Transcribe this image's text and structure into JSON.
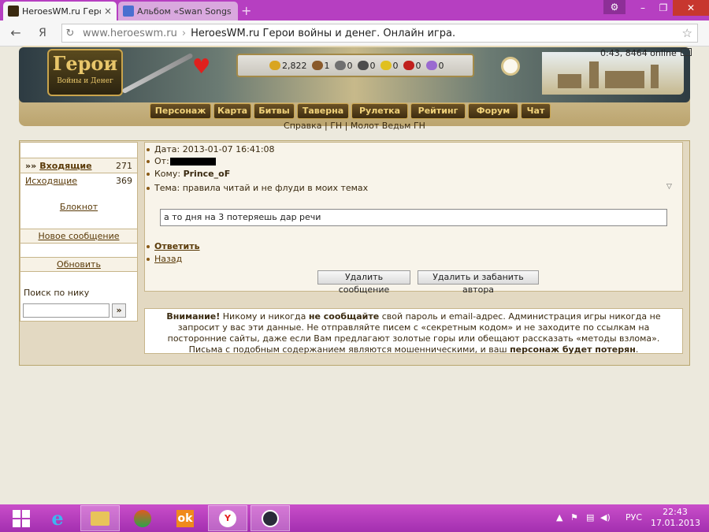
{
  "browser": {
    "tabs": [
      {
        "title": "HeroesWM.ru Герои в",
        "active": true
      },
      {
        "title": "Альбом «Swan Songs",
        "active": false
      }
    ],
    "address": {
      "host": "www.heroeswm.ru",
      "separator": "›",
      "page_title": "HeroesWM.ru Герои войны и денег. Онлайн игра."
    },
    "nav_letter": "Я"
  },
  "header": {
    "logo_title": "Герои",
    "logo_subtitle": "Войны и Денег",
    "resources": [
      {
        "icon": "gold-icon",
        "value": "2,822",
        "color": "#d9a520"
      },
      {
        "icon": "wood-icon",
        "value": "1",
        "color": "#8a5a2a"
      },
      {
        "icon": "ore-icon",
        "value": "0",
        "color": "#707070"
      },
      {
        "icon": "mercury-icon",
        "value": "0",
        "color": "#4d4d4d"
      },
      {
        "icon": "sulfur-icon",
        "value": "0",
        "color": "#e0c020"
      },
      {
        "icon": "crystal-icon",
        "value": "0",
        "color": "#c0201d"
      },
      {
        "icon": "gems-icon",
        "value": "0",
        "color": "#9a6ad0"
      }
    ],
    "online": "0:43, 8464 online",
    "menu": [
      "Персонаж",
      "Карта",
      "Битвы",
      "Таверна",
      "Рулетка",
      "Рейтинг",
      "Форум",
      "Чат"
    ],
    "sublinks": "Справка | ГН | Молот Ведьм ГН"
  },
  "sidebar": {
    "inbox_label": "Входящие",
    "inbox_prefix": "»»",
    "inbox_count": "271",
    "outbox_label": "Исходящие",
    "outbox_count": "369",
    "notepad": "Блокнот",
    "new_message": "Новое сообщение",
    "refresh": "Обновить",
    "search_label": "Поиск по нику",
    "search_value": "",
    "search_button": "»"
  },
  "message": {
    "date_label": "Дата:",
    "date_value": "2013-01-07 16:41:08",
    "from_label": "От:",
    "to_label": "Кому:",
    "to_value": "Prince_oF",
    "subject_label": "Тема:",
    "subject_value": "правила читай и не флуди в моих темах",
    "body": "а то дня на 3 потеряешь дар речи",
    "reply": "Ответить",
    "back": "Назад",
    "delete_button": "Удалить сообщение",
    "delete_ban_button": "Удалить и забанить автора"
  },
  "warning": {
    "attention": "Внимание!",
    "part1": " Никому и никогда ",
    "bold1": "не сообщайте",
    "part2": " свой пароль и email-адрес. Администрация игры никогда не запросит у вас эти данные. Не отправляйте писем с «секретным кодом» и не заходите по ссылкам на посторонние сайты, даже если Вам предлагают золотые горы или обещают рассказать «методы взлома». Письма с подобным содержанием являются мошенническими, и ваш ",
    "bold2": "персонаж будет потерян",
    "end": "."
  },
  "taskbar": {
    "lang": "РУС",
    "time": "22:43",
    "date": "17.01.2013"
  }
}
